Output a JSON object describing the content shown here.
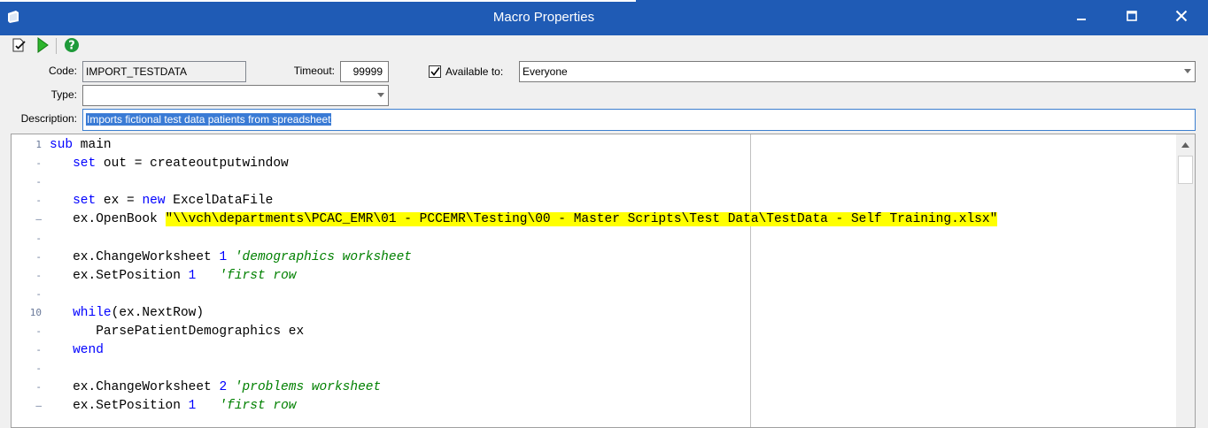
{
  "window": {
    "title": "Macro Properties",
    "accent_color": "#1f5bb5",
    "icons": [
      "app-icon",
      "minimize-icon",
      "maximize-icon",
      "close-icon"
    ]
  },
  "toolbar": {
    "icons": [
      "check-document-icon",
      "run-icon",
      "help-icon"
    ]
  },
  "form": {
    "code_label": "Code:",
    "code_value": "IMPORT_TESTDATA",
    "timeout_label": "Timeout:",
    "timeout_value": "99999",
    "available_label": "Available to:",
    "available_checked": true,
    "available_value": "Everyone",
    "type_label": "Type:",
    "type_value": "",
    "description_label": "Description:",
    "description_value": "Imports fictional test data patients from spreadsheet"
  },
  "editor": {
    "line_markers": [
      "1",
      "-",
      "-",
      "-",
      "–",
      "-",
      "-",
      "-",
      "-",
      "10",
      "-",
      "-",
      "-",
      "-",
      "–"
    ],
    "lines": [
      [
        {
          "t": "kw",
          "v": "sub"
        },
        {
          "t": "p",
          "v": " main"
        }
      ],
      [
        {
          "t": "p",
          "v": "   "
        },
        {
          "t": "kw",
          "v": "set"
        },
        {
          "t": "p",
          "v": " out = createoutputwindow"
        }
      ],
      [],
      [
        {
          "t": "p",
          "v": "   "
        },
        {
          "t": "kw",
          "v": "set"
        },
        {
          "t": "p",
          "v": " ex = "
        },
        {
          "t": "kw",
          "v": "new"
        },
        {
          "t": "p",
          "v": " ExcelDataFile"
        }
      ],
      [
        {
          "t": "p",
          "v": "   ex.OpenBook "
        },
        {
          "t": "str",
          "v": "\"\\\\vch\\departments\\PCAC_EMR\\01 - PCCEMR\\Testing\\00 - Master Scripts\\Test Data\\TestData - Self Training.xlsx\""
        }
      ],
      [],
      [
        {
          "t": "p",
          "v": "   ex.ChangeWorksheet "
        },
        {
          "t": "num",
          "v": "1"
        },
        {
          "t": "p",
          "v": " "
        },
        {
          "t": "cm",
          "v": "'demographics worksheet"
        }
      ],
      [
        {
          "t": "p",
          "v": "   ex.SetPosition "
        },
        {
          "t": "num",
          "v": "1"
        },
        {
          "t": "p",
          "v": "   "
        },
        {
          "t": "cm",
          "v": "'first row"
        }
      ],
      [],
      [
        {
          "t": "p",
          "v": "   "
        },
        {
          "t": "kw",
          "v": "while"
        },
        {
          "t": "p",
          "v": "(ex.NextRow)"
        }
      ],
      [
        {
          "t": "p",
          "v": "      ParsePatientDemographics ex"
        }
      ],
      [
        {
          "t": "p",
          "v": "   "
        },
        {
          "t": "kw",
          "v": "wend"
        }
      ],
      [],
      [
        {
          "t": "p",
          "v": "   ex.ChangeWorksheet "
        },
        {
          "t": "num",
          "v": "2"
        },
        {
          "t": "p",
          "v": " "
        },
        {
          "t": "cm",
          "v": "'problems worksheet"
        }
      ],
      [
        {
          "t": "p",
          "v": "   ex.SetPosition "
        },
        {
          "t": "num",
          "v": "1"
        },
        {
          "t": "p",
          "v": "   "
        },
        {
          "t": "cm",
          "v": "'first row"
        }
      ]
    ]
  }
}
